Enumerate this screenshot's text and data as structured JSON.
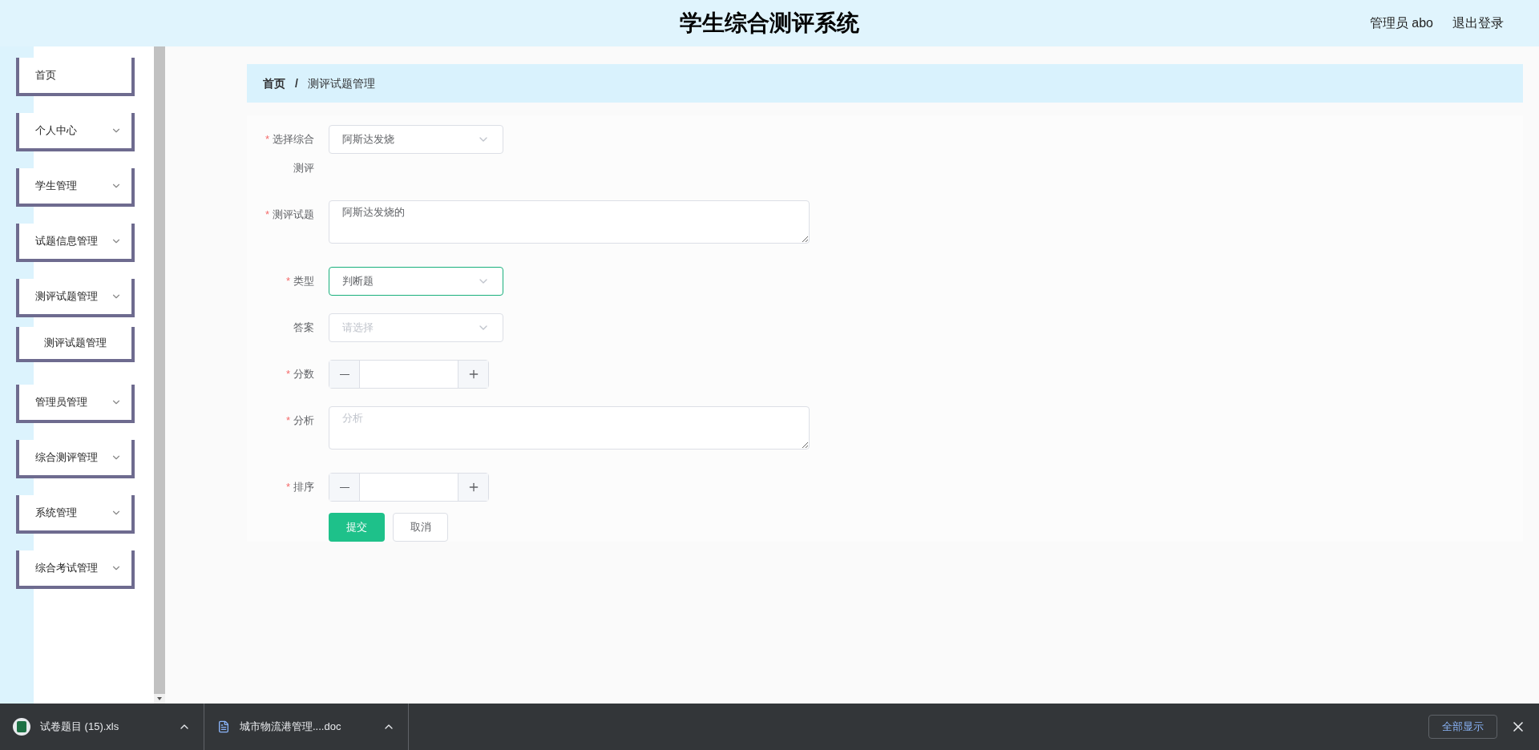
{
  "header": {
    "title": "学生综合测评系统",
    "user": "管理员 abo",
    "logout": "退出登录"
  },
  "sidebar": {
    "items": [
      {
        "label": "首页",
        "has_arrow": false
      },
      {
        "label": "个人中心",
        "has_arrow": true
      },
      {
        "label": "学生管理",
        "has_arrow": true
      },
      {
        "label": "试题信息管理",
        "has_arrow": true
      },
      {
        "label": "测评试题管理",
        "has_arrow": true,
        "children": [
          {
            "label": "测评试题管理"
          }
        ]
      },
      {
        "label": "管理员管理",
        "has_arrow": true
      },
      {
        "label": "综合测评管理",
        "has_arrow": true
      },
      {
        "label": "系统管理",
        "has_arrow": true
      },
      {
        "label": "综合考试管理",
        "has_arrow": true
      }
    ]
  },
  "breadcrumb": {
    "items": [
      "首页",
      "测评试题管理"
    ],
    "separator": "/"
  },
  "form": {
    "fields": [
      {
        "kind": "select",
        "label": "选择综合测评",
        "required": true,
        "value": "阿斯达发烧",
        "focused": false
      },
      {
        "kind": "textarea",
        "label": "测评试题",
        "required": true,
        "value": "阿斯达发烧的"
      },
      {
        "kind": "select",
        "label": "类型",
        "required": true,
        "value": "判断题",
        "focused": true
      },
      {
        "kind": "select",
        "label": "答案",
        "required": false,
        "placeholder": "请选择",
        "focused": false
      },
      {
        "kind": "number",
        "label": "分数",
        "required": true
      },
      {
        "kind": "textarea",
        "label": "分析",
        "required": true,
        "placeholder": "分析"
      },
      {
        "kind": "number",
        "label": "排序",
        "required": true
      }
    ],
    "required_mark": "*",
    "submit": "提交",
    "cancel": "取消"
  },
  "downloads": {
    "items": [
      {
        "name": "试卷题目 (15).xls",
        "kind": "xls"
      },
      {
        "name": "城市物流港管理....doc",
        "kind": "doc"
      }
    ],
    "show_all": "全部显示"
  }
}
